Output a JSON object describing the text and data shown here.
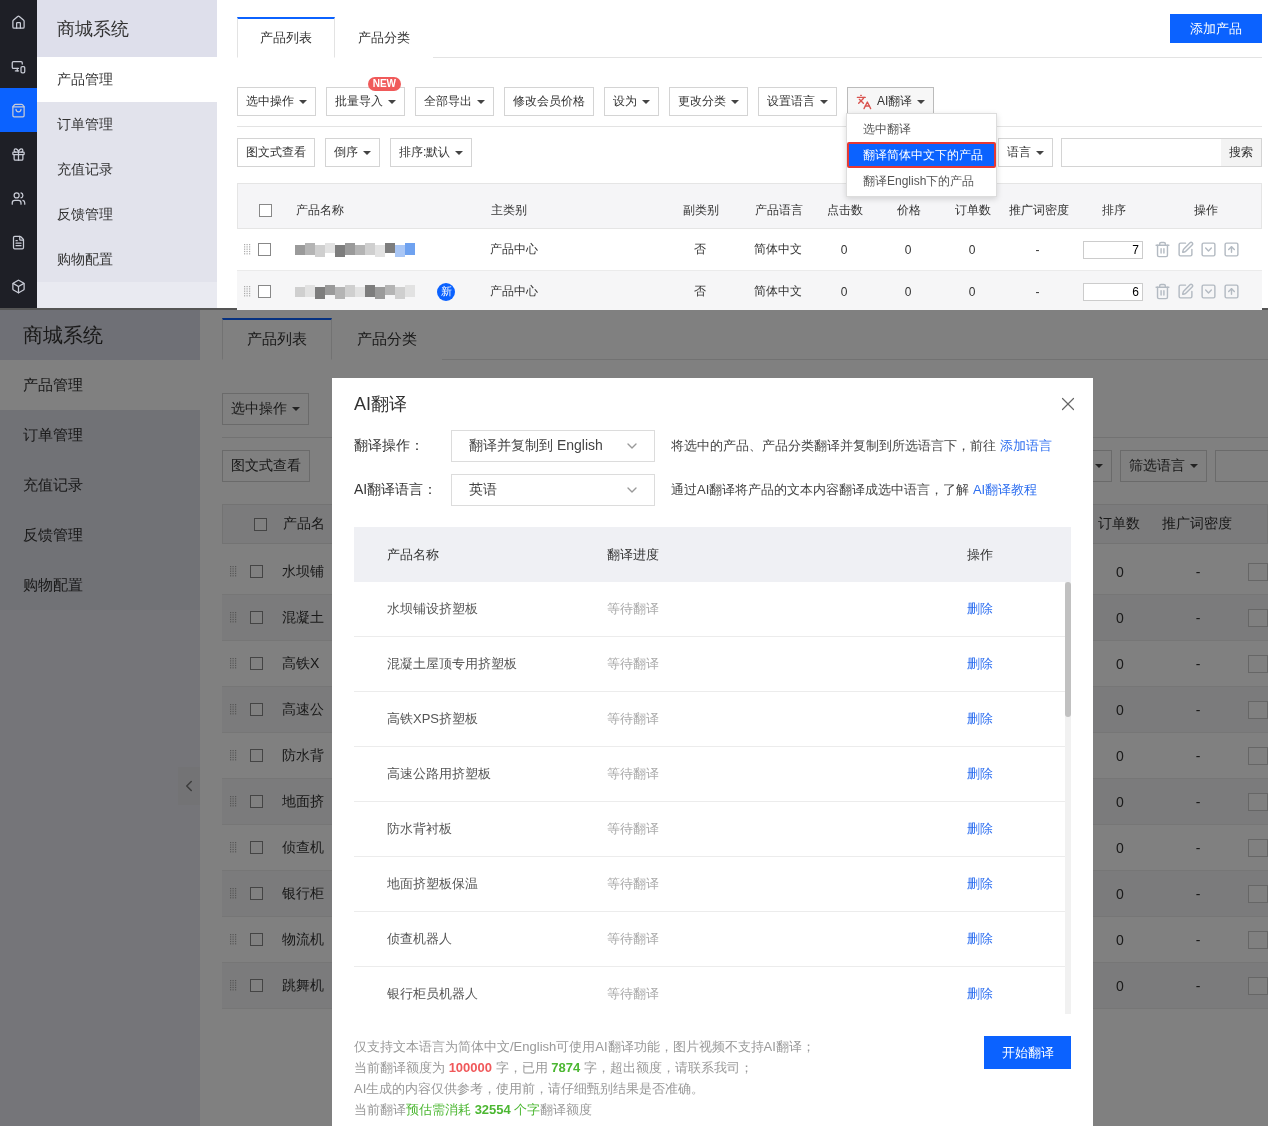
{
  "top": {
    "rail": [
      {
        "selected": false
      },
      {
        "selected": false
      },
      {
        "selected": true
      },
      {
        "selected": false
      },
      {
        "selected": false
      },
      {
        "selected": false
      },
      {
        "selected": false
      }
    ],
    "sidebar": {
      "title": "商城系统",
      "items": [
        {
          "label": "产品管理",
          "selected": true
        },
        {
          "label": "订单管理",
          "selected": false
        },
        {
          "label": "充值记录",
          "selected": false
        },
        {
          "label": "反馈管理",
          "selected": false
        },
        {
          "label": "购物配置",
          "selected": false
        }
      ]
    },
    "tabs": [
      {
        "label": "产品列表",
        "selected": true
      },
      {
        "label": "产品分类",
        "selected": false
      }
    ],
    "add_button": "添加产品",
    "toolbar": [
      {
        "kind": "plain",
        "label": "选中操作",
        "caret": true,
        "expanded": false
      },
      {
        "kind": "plain",
        "label": "批量导入",
        "caret": true,
        "badge": "NEW",
        "expanded": false
      },
      {
        "kind": "plain",
        "label": "全部导出",
        "caret": true,
        "expanded": false
      },
      {
        "kind": "plain",
        "label": "修改会员价格",
        "caret": false,
        "expanded": false
      },
      {
        "kind": "plain",
        "label": "设为",
        "caret": true,
        "expanded": false
      },
      {
        "kind": "plain",
        "label": "更改分类",
        "caret": true,
        "expanded": false
      },
      {
        "kind": "plain",
        "label": "设置语言",
        "caret": true,
        "expanded": false
      },
      {
        "kind": "translate",
        "label": "AI翻译",
        "caret": true,
        "expanded": true,
        "menu": [
          {
            "label": "选中翻译",
            "selected": false
          },
          {
            "label": "翻译简体中文下的产品",
            "selected": true
          },
          {
            "label": "翻译English下的产品",
            "selected": false
          }
        ]
      }
    ],
    "toolbar2": [
      {
        "label": "图文式查看",
        "caret": false
      },
      {
        "label": "倒序",
        "caret": true
      },
      {
        "label": "排序:默认",
        "caret": true
      }
    ],
    "filter": {
      "label": "语言",
      "caret": true
    },
    "search": {
      "button": "搜索"
    },
    "table": {
      "columns": [
        "产品名称",
        "主类别",
        "副类别",
        "产品语言",
        "点击数",
        "价格",
        "订单数",
        "推广词密度",
        "排序",
        "操作"
      ],
      "all_checked": false,
      "rows": [
        {
          "checked": false,
          "main_category": "产品中心",
          "sub_category": "否",
          "language": "简体中文",
          "clicks": "0",
          "price": "0",
          "orders": "0",
          "density": "-",
          "sort": "7"
        },
        {
          "checked": false,
          "badge": "新",
          "main_category": "产品中心",
          "sub_category": "否",
          "language": "简体中文",
          "clicks": "0",
          "price": "0",
          "orders": "0",
          "density": "-",
          "sort": "6"
        }
      ]
    }
  },
  "bottom": {
    "sidebar": {
      "title": "商城系统",
      "items": [
        {
          "label": "产品管理",
          "selected": true
        },
        {
          "label": "订单管理",
          "selected": false
        },
        {
          "label": "充值记录",
          "selected": false
        },
        {
          "label": "反馈管理",
          "selected": false
        },
        {
          "label": "购物配置",
          "selected": false
        }
      ]
    },
    "tabs": [
      {
        "label": "产品列表",
        "selected": true
      },
      {
        "label": "产品分类",
        "selected": false
      }
    ],
    "toolbar": [
      {
        "label": "选中操作",
        "caret": true
      }
    ],
    "toolbar2": [
      {
        "label": "图文式查看",
        "caret": false
      }
    ],
    "filters": [
      {
        "caret": true
      },
      {
        "label": "筛选语言",
        "caret": true
      }
    ],
    "table": {
      "columns": [
        "产品名",
        "订单数",
        "推广词密度"
      ],
      "all_checked": false,
      "rows": [
        {
          "name": "水坝铺",
          "checked": false,
          "orders": "0",
          "density": "-"
        },
        {
          "name": "混凝土",
          "checked": false,
          "orders": "0",
          "density": "-"
        },
        {
          "name": "高铁X",
          "checked": false,
          "orders": "0",
          "density": "-"
        },
        {
          "name": "高速公",
          "checked": false,
          "orders": "0",
          "density": "-"
        },
        {
          "name": "防水背",
          "checked": false,
          "orders": "0",
          "density": "-"
        },
        {
          "name": "地面挤",
          "checked": false,
          "orders": "0",
          "density": "-"
        },
        {
          "name": "侦查机",
          "checked": false,
          "orders": "0",
          "density": "-"
        },
        {
          "name": "银行柜",
          "checked": false,
          "orders": "0",
          "density": "-"
        },
        {
          "name": "物流机",
          "checked": false,
          "orders": "0",
          "density": "-"
        },
        {
          "name": "跳舞机",
          "checked": false,
          "orders": "0",
          "density": "-"
        }
      ]
    },
    "modal": {
      "title": "AI翻译",
      "fields": [
        {
          "label": "翻译操作：",
          "value": "翻译并复制到 English",
          "hint": "将选中的产品、产品分类翻译并复制到所选语言下，前往",
          "link": "添加语言"
        },
        {
          "label": "AI翻译语言：",
          "value": "英语",
          "hint": "通过AI翻译将产品的文本内容翻译成选中语言，了解",
          "link": "AI翻译教程"
        }
      ],
      "table": {
        "columns": [
          "产品名称",
          "翻译进度",
          "操作"
        ],
        "rows": [
          {
            "name": "水坝铺设挤塑板",
            "status": "等待翻译",
            "action": "删除"
          },
          {
            "name": "混凝土屋顶专用挤塑板",
            "status": "等待翻译",
            "action": "删除"
          },
          {
            "name": "高铁XPS挤塑板",
            "status": "等待翻译",
            "action": "删除"
          },
          {
            "name": "高速公路用挤塑板",
            "status": "等待翻译",
            "action": "删除"
          },
          {
            "name": "防水背衬板",
            "status": "等待翻译",
            "action": "删除"
          },
          {
            "name": "地面挤塑板保温",
            "status": "等待翻译",
            "action": "删除"
          },
          {
            "name": "侦查机器人",
            "status": "等待翻译",
            "action": "删除"
          },
          {
            "name": "银行柜员机器人",
            "status": "等待翻译",
            "action": "删除"
          }
        ]
      },
      "notes": [
        [
          {
            "text": "仅支持文本语言为简体中文/English可使用AI翻译功能，图片视频不支持AI翻译；",
            "color": "#999999"
          }
        ],
        [
          {
            "text": "当前翻译额度为 ",
            "color": "#999999"
          },
          {
            "text": "**100000**",
            "color": "#f0585a"
          },
          {
            "text": " 字，已用 ",
            "color": "#999999"
          },
          {
            "text": "**7874**",
            "color": "#4cb732"
          },
          {
            "text": " 字，超出额度，请联系我司；",
            "color": "#999999"
          }
        ],
        [
          {
            "text": "AI生成的内容仅供参考，使用前，请仔细甄别结果是否准确。",
            "color": "#999999"
          }
        ],
        [
          {
            "text": "当前翻译",
            "color": "#999999"
          },
          {
            "text": "预估需消耗 **32554** 个字",
            "color": "#4cb732"
          },
          {
            "text": "翻译额度",
            "color": "#999999"
          }
        ]
      ],
      "start_button": "开始翻译"
    }
  }
}
